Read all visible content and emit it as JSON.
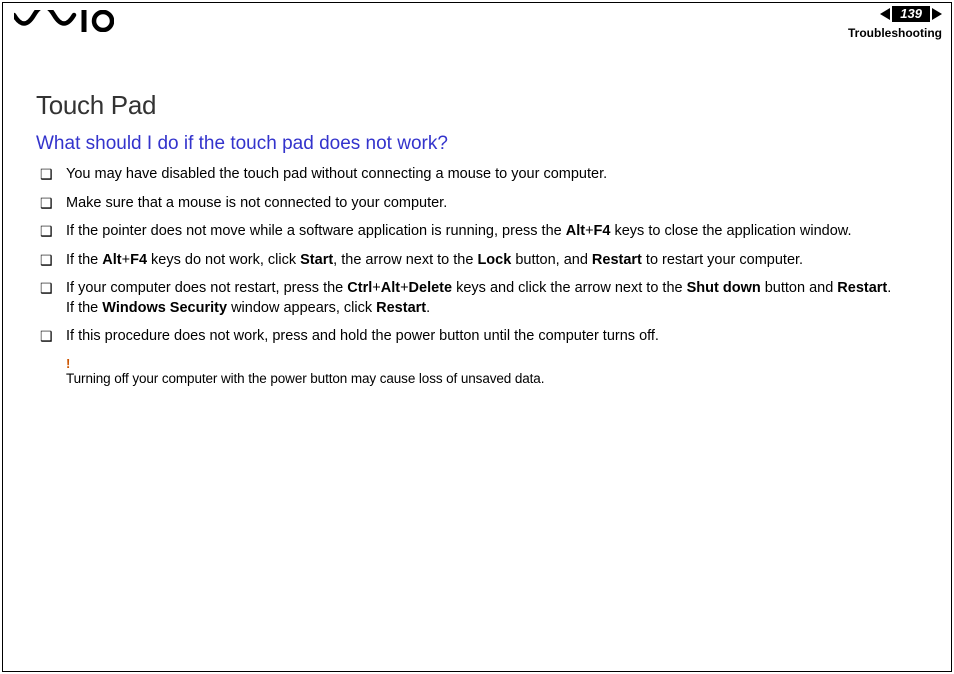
{
  "header": {
    "page_number": "139",
    "section": "Troubleshooting",
    "n_glyph": "n",
    "N_glyph": "N"
  },
  "content": {
    "title": "Touch Pad",
    "subtitle": "What should I do if the touch pad does not work?",
    "items": [
      {
        "html": "You may have disabled the touch pad without connecting a mouse to your computer."
      },
      {
        "html": "Make sure that a mouse is not connected to your computer."
      },
      {
        "html": "If the pointer does not move while a software application is running, press the <b>Alt</b>+<b>F4</b> keys to close the application window."
      },
      {
        "html": "If the <b>Alt</b>+<b>F4</b> keys do not work, click <b>Start</b>, the arrow next to the <b>Lock</b> button, and <b>Restart</b> to restart your computer."
      },
      {
        "html": "If your computer does not restart, press the <b>Ctrl</b>+<b>Alt</b>+<b>Delete</b> keys and click the arrow next to the <b>Shut down</b> button and <b>Restart</b>.<br>If the <b>Windows Security</b> window appears, click <b>Restart</b>."
      },
      {
        "html": "If this procedure does not work, press and hold the power button until the computer turns off."
      }
    ],
    "warning_mark": "!",
    "warning_text": "Turning off your computer with the power button may cause loss of unsaved data."
  }
}
